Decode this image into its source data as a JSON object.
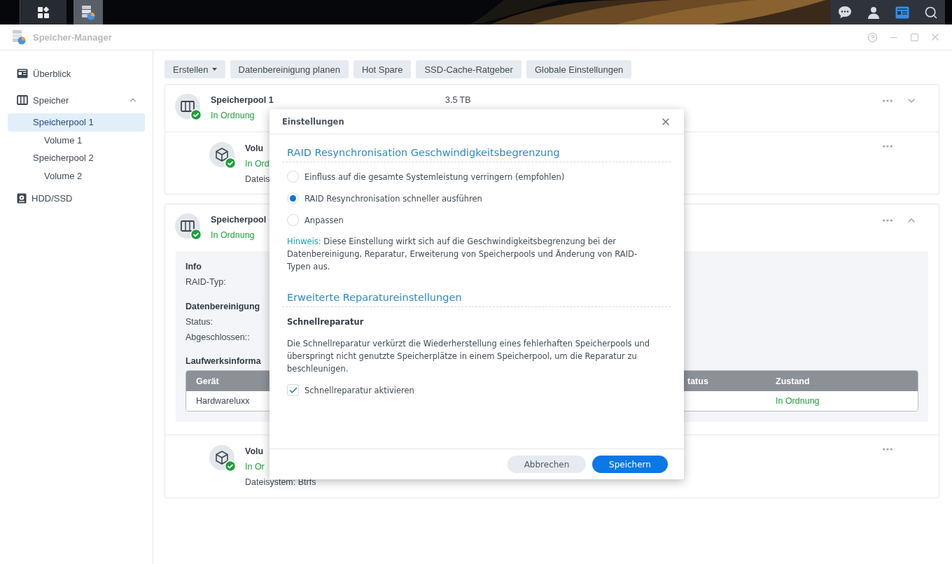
{
  "taskbar": {
    "apps": [
      {
        "selected": false
      },
      {
        "selected": true
      }
    ],
    "tray": [
      {
        "selected": false
      },
      {
        "selected": false
      },
      {
        "selected": true
      },
      {
        "selected": false
      }
    ]
  },
  "window": {
    "title": "Speicher-Manager"
  },
  "sidebar": {
    "items": [
      {
        "label": "Überblick",
        "selected": false
      },
      {
        "label": "Speicher",
        "selected": false,
        "expanded": true,
        "children": [
          {
            "label": "Speicherpool 1",
            "selected": true,
            "children": [
              {
                "label": "Volume 1",
                "selected": false
              }
            ]
          },
          {
            "label": "Speicherpool 2",
            "selected": false,
            "children": [
              {
                "label": "Volume 2",
                "selected": false
              }
            ]
          }
        ]
      },
      {
        "label": "HDD/SSD",
        "selected": false
      }
    ]
  },
  "toolbar": [
    {
      "label": "Erstellen",
      "kind": "dropdown"
    },
    {
      "label": "Datenbereinigung planen",
      "kind": "button"
    },
    {
      "label": "Hot Spare",
      "kind": "button"
    },
    {
      "label": "SSD-Cache-Ratgeber",
      "kind": "button"
    },
    {
      "label": "Globale Einstellungen",
      "kind": "button"
    }
  ],
  "pools": [
    {
      "name": "Speicherpool 1",
      "status": "In Ordnung",
      "size": "3.5 TB",
      "expanded": false,
      "volumes": [
        {
          "name": "Volu",
          "status": "In Ord",
          "filesystem": "Dateis"
        }
      ]
    },
    {
      "name": "Speicherpool",
      "status": "In Ordnung",
      "expanded": true,
      "details": {
        "info_title": "Info",
        "raid_label": "RAID-Typ:",
        "scrub_title": "Datenbereinigung",
        "scrub_status_label": "Status:",
        "scrub_done_label": "Abgeschlossen::",
        "drives_title": "Laufwerksinforma",
        "columns": [
          "Gerät",
          "tatus",
          "Zustand"
        ],
        "rows": [
          {
            "device": "Hardwareluxx",
            "condition": "In Ordnung"
          }
        ]
      },
      "volumes": [
        {
          "name": "Volu",
          "status": "In Or",
          "filesystem": "Dateisystem: Btrfs"
        }
      ]
    }
  ],
  "dialog": {
    "title": "Einstellungen",
    "sections": [
      {
        "title": "RAID Resynchronisation Geschwindigkeitsbegrenzung",
        "items": [
          {
            "kind": "radio",
            "label": "Einfluss auf die gesamte Systemleistung verringern (empfohlen)",
            "selected": false
          },
          {
            "kind": "radio",
            "label": "RAID Resynchronisation schneller ausführen",
            "selected": true
          },
          {
            "kind": "radio",
            "label": "Anpassen",
            "selected": false
          },
          {
            "kind": "note",
            "label": "Hinweis:",
            "text": "Diese Einstellung wirkt sich auf die Geschwindigkeitsbegrenzung bei der Datenbereinigung, Reparatur, Erweiterung von Speicherpools und Änderung von RAID-Typen aus."
          }
        ]
      },
      {
        "title": "Erweiterte Reparatureinstellungen",
        "items": [
          {
            "kind": "subheading",
            "text": "Schnellreparatur"
          },
          {
            "kind": "paragraph",
            "text": "Die Schnellreparatur verkürzt die Wiederherstellung eines fehlerhaften Speicherpools und überspringt nicht genutzte Speicherplätze in einem Speicherpool, um die Reparatur zu beschleunigen."
          },
          {
            "kind": "checkbox",
            "label": "Schnellreparatur aktivieren",
            "checked": true
          }
        ]
      }
    ],
    "buttons": [
      {
        "label": "Abbrechen",
        "primary": false
      },
      {
        "label": "Speichern",
        "primary": true
      }
    ]
  }
}
